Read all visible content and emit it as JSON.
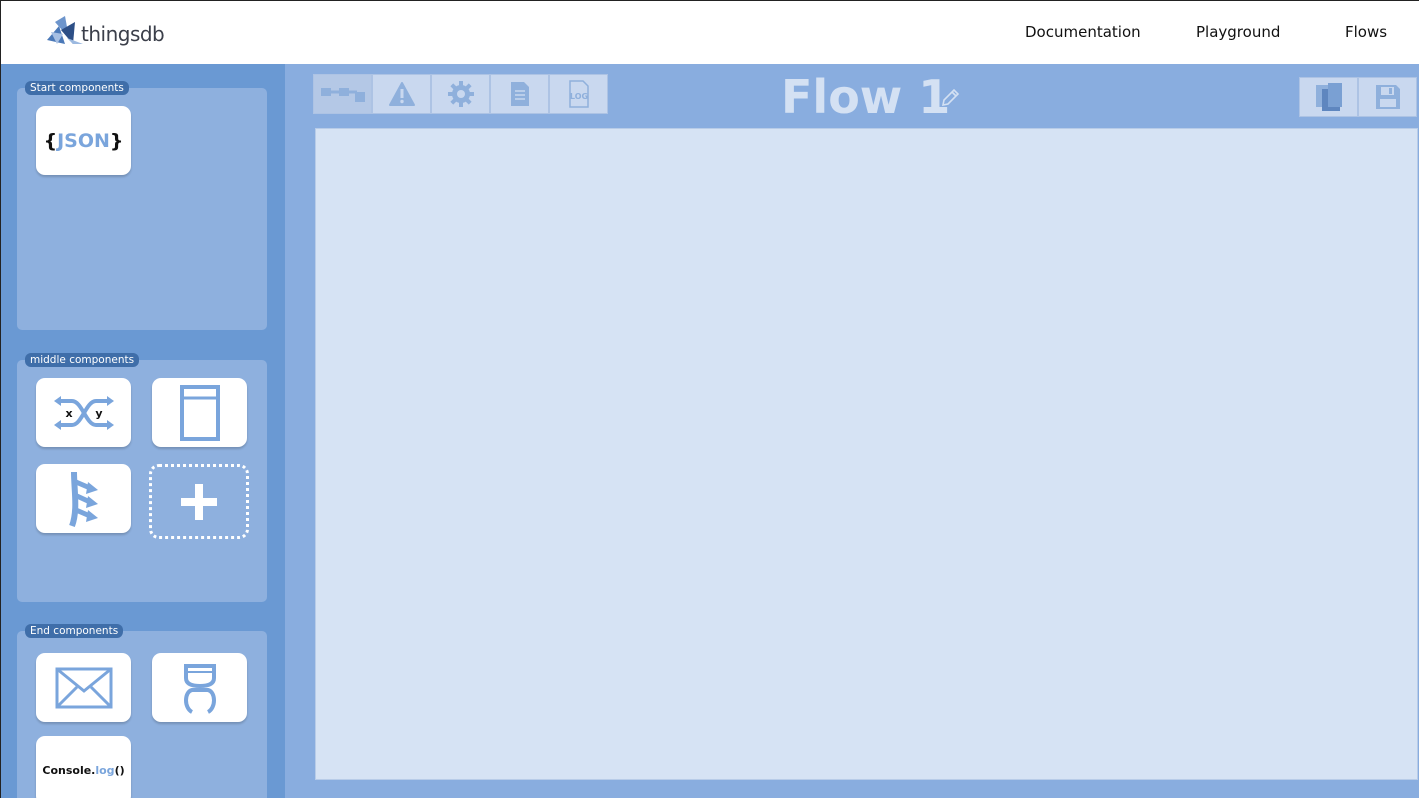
{
  "header": {
    "logo_text": "thingsdb",
    "nav": [
      {
        "label": "Documentation"
      },
      {
        "label": "Playground"
      },
      {
        "label": "Flows"
      }
    ]
  },
  "sidebar": {
    "start": {
      "title": "Start components",
      "items": [
        {
          "name": "json",
          "icon": "json-icon",
          "brace_open": "{",
          "word": "JSON",
          "brace_close": "}"
        }
      ]
    },
    "middle": {
      "title": "middle components",
      "items": [
        {
          "name": "map",
          "icon": "xy-swap-icon",
          "x": "x",
          "y": "y"
        },
        {
          "name": "storage",
          "icon": "panel-icon"
        },
        {
          "name": "split",
          "icon": "split-arrows-icon"
        },
        {
          "name": "add",
          "icon": "plus-icon"
        }
      ]
    },
    "end": {
      "title": "End components",
      "items": [
        {
          "name": "mail",
          "icon": "envelope-icon"
        },
        {
          "name": "bot",
          "icon": "robot-icon"
        },
        {
          "name": "console",
          "icon": "console-icon",
          "prefix": "Console.",
          "suffix": "log",
          "parens": "()"
        }
      ]
    }
  },
  "main": {
    "flow_title": "Flow 1",
    "toolbar": [
      {
        "icon": "flow-diagram-icon",
        "active": true
      },
      {
        "icon": "warning-icon"
      },
      {
        "icon": "gear-icon"
      },
      {
        "icon": "document-icon"
      },
      {
        "icon": "log-file-icon",
        "label": "LOG"
      }
    ],
    "right_tools": [
      {
        "icon": "copy-icon"
      },
      {
        "icon": "save-icon"
      }
    ]
  },
  "colors": {
    "sidebar_bg": "#6a99d3",
    "panel_bg": "#8eb0de",
    "main_bg": "#89addf",
    "canvas_bg": "#d6e3f4",
    "accent": "#7aa5dc",
    "tag_bg": "#3f6ea9"
  }
}
